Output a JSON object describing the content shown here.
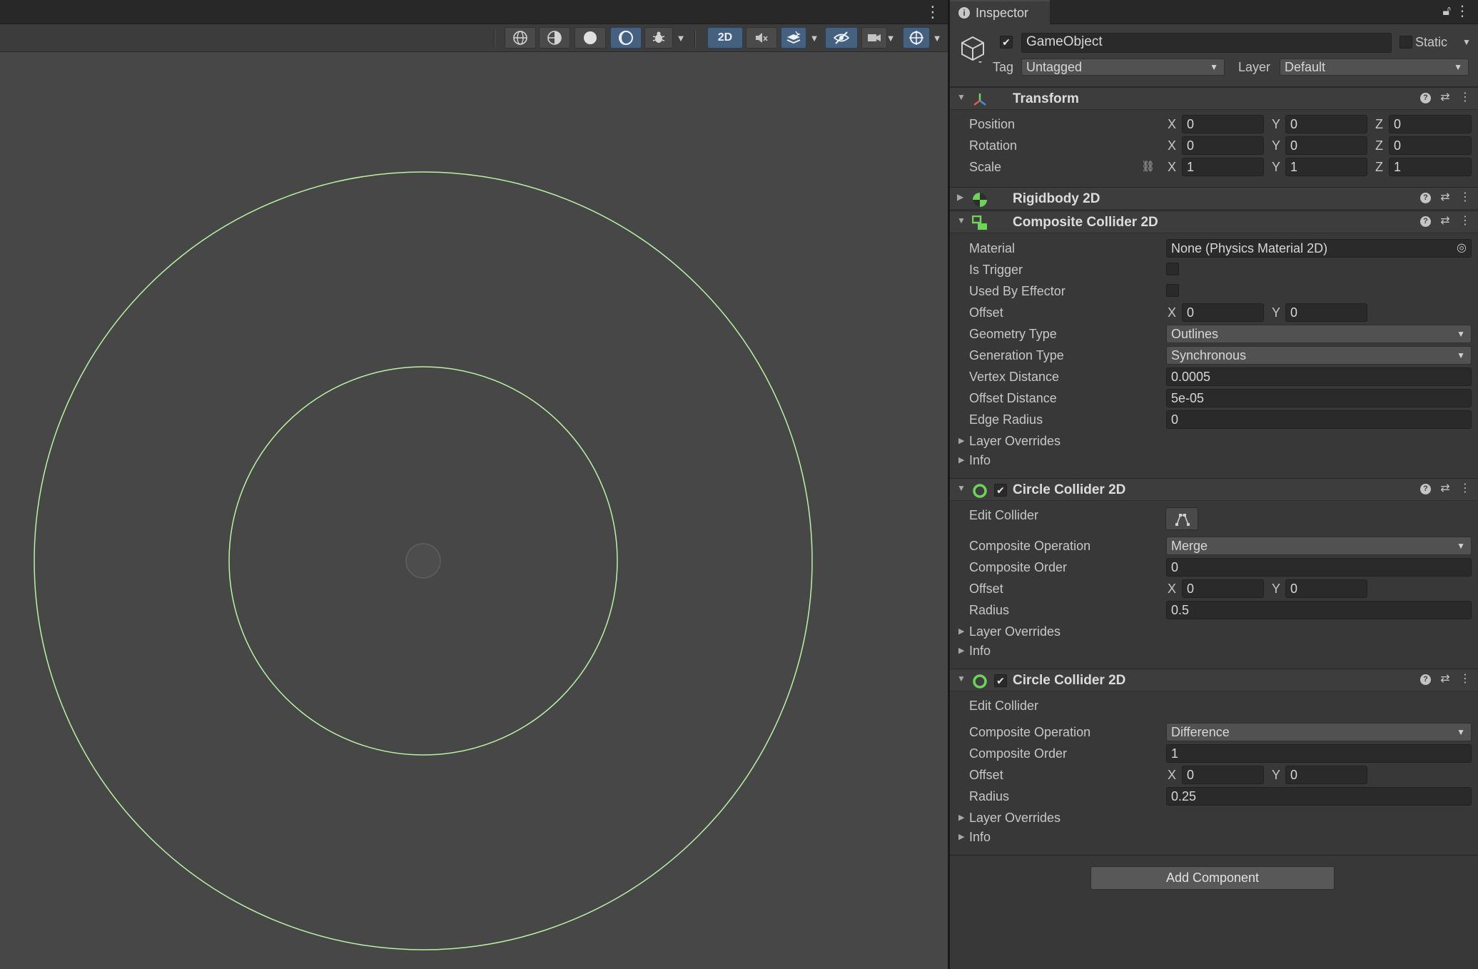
{
  "scene": {
    "toolbar": {
      "btn_2d": "2D"
    }
  },
  "inspector": {
    "tab_title": "Inspector",
    "gameobject": {
      "name": "GameObject",
      "active": true,
      "static_label": "Static",
      "tag_label": "Tag",
      "tag_value": "Untagged",
      "layer_label": "Layer",
      "layer_value": "Default"
    },
    "transform": {
      "title": "Transform",
      "position_label": "Position",
      "rotation_label": "Rotation",
      "scale_label": "Scale",
      "axis_x": "X",
      "axis_y": "Y",
      "axis_z": "Z",
      "position": {
        "x": "0",
        "y": "0",
        "z": "0"
      },
      "rotation": {
        "x": "0",
        "y": "0",
        "z": "0"
      },
      "scale": {
        "x": "1",
        "y": "1",
        "z": "1"
      }
    },
    "rigidbody": {
      "title": "Rigidbody 2D"
    },
    "composite": {
      "title": "Composite Collider 2D",
      "material_label": "Material",
      "material_value": "None (Physics Material 2D)",
      "is_trigger_label": "Is Trigger",
      "used_by_effector_label": "Used By Effector",
      "offset_label": "Offset",
      "offset": {
        "x": "0",
        "y": "0"
      },
      "geometry_type_label": "Geometry Type",
      "geometry_type_value": "Outlines",
      "generation_type_label": "Generation Type",
      "generation_type_value": "Synchronous",
      "vertex_distance_label": "Vertex Distance",
      "vertex_distance_value": "0.0005",
      "offset_distance_label": "Offset Distance",
      "offset_distance_value": "5e-05",
      "edge_radius_label": "Edge Radius",
      "edge_radius_value": "0",
      "layer_overrides_label": "Layer Overrides",
      "info_label": "Info"
    },
    "circle1": {
      "title": "Circle Collider 2D",
      "enabled": true,
      "edit_collider_label": "Edit Collider",
      "composite_operation_label": "Composite Operation",
      "composite_operation_value": "Merge",
      "composite_order_label": "Composite Order",
      "composite_order_value": "0",
      "offset_label": "Offset",
      "offset": {
        "x": "0",
        "y": "0"
      },
      "radius_label": "Radius",
      "radius_value": "0.5",
      "layer_overrides_label": "Layer Overrides",
      "info_label": "Info"
    },
    "circle2": {
      "title": "Circle Collider 2D",
      "enabled": true,
      "edit_collider_label": "Edit Collider",
      "composite_operation_label": "Composite Operation",
      "composite_operation_value": "Difference",
      "composite_order_label": "Composite Order",
      "composite_order_value": "1",
      "offset_label": "Offset",
      "offset": {
        "x": "0",
        "y": "0"
      },
      "radius_label": "Radius",
      "radius_value": "0.25",
      "layer_overrides_label": "Layer Overrides",
      "info_label": "Info"
    },
    "add_component_label": "Add Component"
  },
  "colors": {
    "collider_outline": "#b9f2a6",
    "component_icon_green": "#6fd35a",
    "accent_button": "#46607f"
  }
}
